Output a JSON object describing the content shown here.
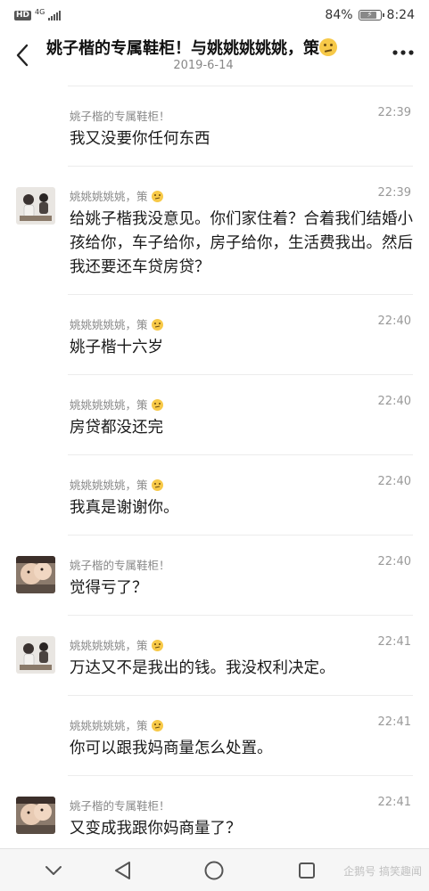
{
  "status_bar": {
    "hd": "HD",
    "network": "4G",
    "battery": "84%",
    "battery_level": 0.84,
    "time": "8:24"
  },
  "header": {
    "title": "姚子楷的专属鞋柜！与姚姚姚姚姚，策",
    "date": "2019-6-14",
    "back_icon": "chevron-left-icon",
    "more_icon": "more-dots-icon"
  },
  "messages": [
    {
      "sender": "姚子楷的专属鞋柜！",
      "time": "22:39",
      "text": "我又没要你任何东西",
      "avatar": "none"
    },
    {
      "sender": "姚姚姚姚姚，策",
      "time": "22:39",
      "text": "给姚子楷我没意见。你们家住着？合着我们结婚小孩给你，车子给你，房子给你，生活费我出。然后我还要还车贷房贷？",
      "avatar": "b"
    },
    {
      "sender": "姚姚姚姚姚，策",
      "time": "22:40",
      "text": "姚子楷十六岁",
      "avatar": "none"
    },
    {
      "sender": "姚姚姚姚姚，策",
      "time": "22:40",
      "text": "房贷都没还完",
      "avatar": "none"
    },
    {
      "sender": "姚姚姚姚姚，策",
      "time": "22:40",
      "text": "我真是谢谢你。",
      "avatar": "none"
    },
    {
      "sender": "姚子楷的专属鞋柜！",
      "time": "22:40",
      "text": "觉得亏了？",
      "avatar": "a"
    },
    {
      "sender": "姚姚姚姚姚，策",
      "time": "22:41",
      "text": "万达又不是我出的钱。我没权利决定。",
      "avatar": "b"
    },
    {
      "sender": "姚姚姚姚姚，策",
      "time": "22:41",
      "text": "你可以跟我妈商量怎么处置。",
      "avatar": "none"
    },
    {
      "sender": "姚子楷的专属鞋柜！",
      "time": "22:41",
      "text": "又变成我跟你妈商量了？",
      "avatar": "a"
    }
  ],
  "nav_bar": {
    "back_icon": "triangle-back-icon",
    "home_icon": "circle-home-icon",
    "recents_icon": "square-recents-icon",
    "collapse_icon": "chevron-down-icon",
    "watermark": "企鹅号 搞笑趣闻"
  }
}
